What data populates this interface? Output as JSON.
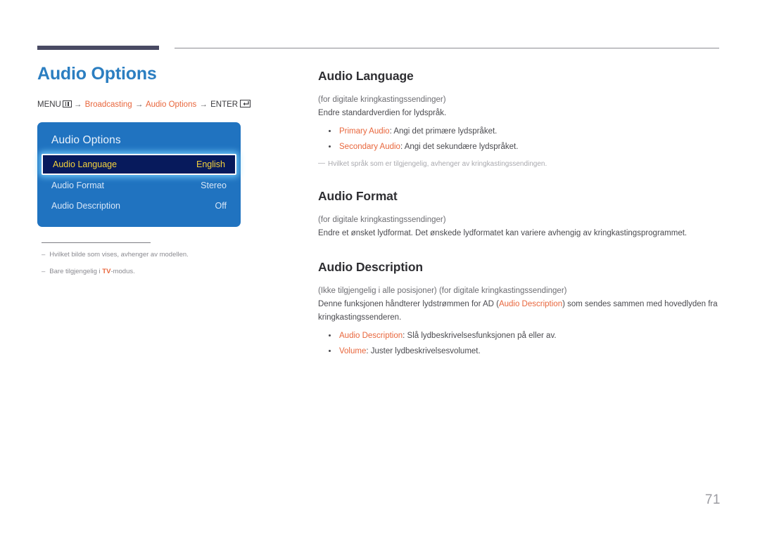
{
  "header": {
    "accent_color": "#494a63",
    "rule_color": "#8d8d92"
  },
  "left": {
    "page_title": "Audio Options",
    "breadcrumb": {
      "menu_label": "MENU",
      "menu_icon": "menu-grid-icon",
      "arrow": "→",
      "crumb1": "Broadcasting",
      "crumb2": "Audio Options",
      "enter_label": "ENTER",
      "enter_icon": "enter-return-icon"
    },
    "osd": {
      "title": "Audio Options",
      "rows": [
        {
          "label": "Audio Language",
          "value": "English",
          "selected": true
        },
        {
          "label": "Audio Format",
          "value": "Stereo",
          "selected": false
        },
        {
          "label": "Audio Description",
          "value": "Off",
          "selected": false
        }
      ],
      "panel_color": "#2073c0",
      "selected_fill": "#071a5c",
      "selected_text": "#f5d33c"
    },
    "footnotes": [
      {
        "dash": "–",
        "text": "Hvilket bilde som vises, avhenger av modellen.",
        "highlight": ""
      },
      {
        "dash": "–",
        "text_before": "Bare tilgjengelig i ",
        "highlight": "TV",
        "text_after": "-modus."
      }
    ]
  },
  "right": {
    "sections": [
      {
        "title": "Audio Language",
        "lines": [
          "(for digitale kringkastingssendinger)",
          "Endre standardverdien for lydspråk."
        ],
        "bullets": [
          {
            "term": "Primary Audio",
            "text": ": Angi det primære lydspråket."
          },
          {
            "term": "Secondary Audio",
            "text": ": Angi det sekundære lydspråket."
          }
        ],
        "note": "Hvilket språk som er tilgjengelig, avhenger av kringkastingssendingen.",
        "note_dash": "—"
      },
      {
        "title": "Audio Format",
        "lines": [
          "(for digitale kringkastingssendinger)",
          "Endre et ønsket lydformat. Det ønskede lydformatet kan variere avhengig av kringkastingsprogrammet."
        ],
        "bullets": [],
        "note": "",
        "note_dash": ""
      },
      {
        "title": "Audio Description",
        "lines": [
          "(Ikke tilgjengelig i alle posisjoner) (for digitale kringkastingssendinger)"
        ],
        "rich_line": {
          "before": "Denne funksjonen håndterer lydstrømmen for AD (",
          "term": "Audio Description",
          "after": ") som sendes sammen med hovedlyden fra kringkastingssenderen."
        },
        "bullets": [
          {
            "term": "Audio Description",
            "text": ": Slå lydbeskrivelsesfunksjonen på eller av."
          },
          {
            "term": "Volume",
            "text": ": Juster lydbeskrivelsesvolumet."
          }
        ],
        "note": "",
        "note_dash": ""
      }
    ]
  },
  "page_number": "71",
  "colors": {
    "title_blue": "#2b7ec1",
    "accent_orange": "#e8663c",
    "body_gray": "#4a4a4f"
  }
}
